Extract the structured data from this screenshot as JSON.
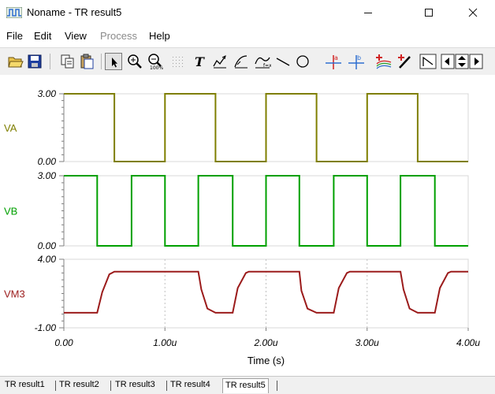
{
  "window": {
    "title": "Noname - TR result5",
    "minimize_glyph": "—",
    "maximize_glyph": "☐",
    "close_glyph": "✕"
  },
  "menu": [
    {
      "label": "File",
      "enabled": true
    },
    {
      "label": "Edit",
      "enabled": true
    },
    {
      "label": "View",
      "enabled": true
    },
    {
      "label": "Process",
      "enabled": false
    },
    {
      "label": "Help",
      "enabled": true
    }
  ],
  "toolbar": {
    "text_tool_glyph": "T"
  },
  "colors": {
    "VA": "#7f7f00",
    "VB": "#00a000",
    "VM3": "#9b1b1b",
    "grid": "#c0c0c0",
    "axis": "#808080"
  },
  "chart_data": [
    {
      "type": "line",
      "series": [
        {
          "name": "VA",
          "x": [
            "0.00",
            "0.50u",
            "0.50u",
            "1.00u",
            "1.00u",
            "1.50u",
            "1.50u",
            "2.00u",
            "2.00u",
            "2.50u",
            "2.50u",
            "3.00u",
            "3.00u",
            "3.50u",
            "3.50u",
            "4.00u"
          ],
          "x_us": [
            0,
            0.5,
            0.5,
            1.0,
            1.0,
            1.5,
            1.5,
            2.0,
            2.0,
            2.5,
            2.5,
            3.0,
            3.0,
            3.5,
            3.5,
            4.0
          ],
          "y": [
            3,
            3,
            0,
            0,
            3,
            3,
            0,
            0,
            3,
            3,
            0,
            0,
            3,
            3,
            0,
            0
          ]
        }
      ],
      "ylabel": "VA",
      "ytick_labels": [
        "3.00",
        "0.00"
      ],
      "ylim": [
        0,
        3
      ],
      "xlim": [
        0,
        4
      ]
    },
    {
      "type": "line",
      "series": [
        {
          "name": "VB",
          "x_us": [
            0,
            0.33,
            0.33,
            0.67,
            0.67,
            1.0,
            1.0,
            1.33,
            1.33,
            1.67,
            1.67,
            2.0,
            2.0,
            2.33,
            2.33,
            2.67,
            2.67,
            3.0,
            3.0,
            3.33,
            3.33,
            3.67,
            3.67,
            4.0
          ],
          "y": [
            3,
            3,
            0,
            0,
            3,
            3,
            0,
            0,
            3,
            3,
            0,
            0,
            3,
            3,
            0,
            0,
            3,
            3,
            0,
            0,
            3,
            3,
            0,
            0
          ]
        }
      ],
      "ylabel": "VB",
      "ytick_labels": [
        "3.00",
        "0.00"
      ],
      "ylim": [
        0,
        3
      ],
      "xlim": [
        0,
        4
      ]
    },
    {
      "type": "line",
      "series": [
        {
          "name": "VM3",
          "x_us": [
            0,
            0.33,
            0.38,
            0.45,
            0.5,
            1.33,
            1.36,
            1.42,
            1.5,
            1.67,
            1.72,
            1.8,
            1.83,
            2.33,
            2.35,
            2.41,
            2.5,
            2.67,
            2.72,
            2.8,
            2.83,
            3.33,
            3.36,
            3.42,
            3.5,
            3.67,
            3.72,
            3.8,
            3.83,
            4.0
          ],
          "y": [
            0.1,
            0.1,
            1.6,
            2.9,
            3.1,
            3.1,
            1.8,
            0.4,
            0.1,
            0.1,
            1.9,
            3.0,
            3.1,
            3.1,
            1.7,
            0.4,
            0.1,
            0.1,
            1.9,
            3.0,
            3.1,
            3.1,
            1.8,
            0.4,
            0.1,
            0.1,
            1.9,
            3.0,
            3.1,
            3.1
          ]
        }
      ],
      "ylabel": "VM3",
      "ytick_labels": [
        "4.00",
        "-1.00"
      ],
      "ylim": [
        -1,
        4
      ],
      "xlim": [
        0,
        4
      ],
      "xtick_labels": [
        "0.00",
        "1.00u",
        "2.00u",
        "3.00u",
        "4.00u"
      ],
      "xlabel": "Time (s)"
    }
  ],
  "tabs": [
    {
      "label": "TR result1",
      "active": false
    },
    {
      "label": "TR result2",
      "active": false
    },
    {
      "label": "TR result3",
      "active": false
    },
    {
      "label": "TR result4",
      "active": false
    },
    {
      "label": "TR result5",
      "active": true
    }
  ]
}
